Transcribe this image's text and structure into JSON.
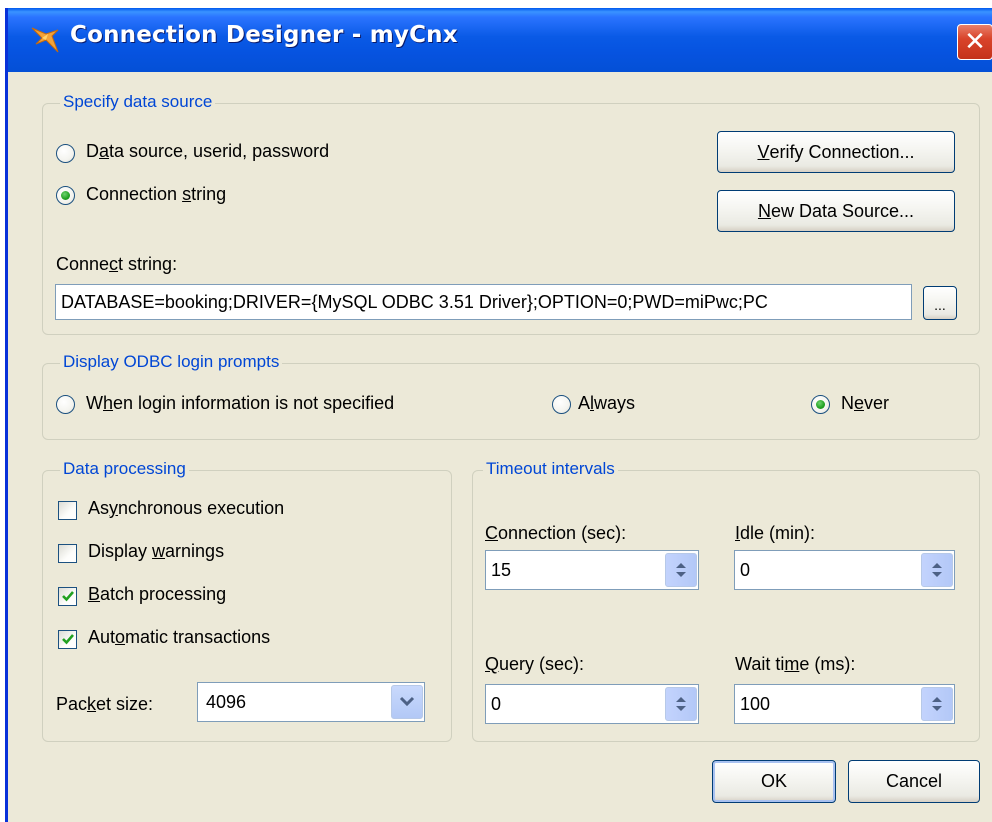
{
  "window": {
    "title": "Connection Designer - myCnx",
    "close_glyph": "✕"
  },
  "data_source": {
    "legend": "Specify data source",
    "option_dsn": {
      "pre": "D",
      "ul": "a",
      "post": "ta source, userid, password",
      "checked": false
    },
    "option_string": {
      "pre": "Connection ",
      "ul": "s",
      "post": "tring",
      "checked": true
    },
    "verify_button": {
      "pre": "",
      "ul": "V",
      "post": "erify Connection..."
    },
    "new_ds_button": {
      "pre": "",
      "ul": "N",
      "post": "ew Data Source..."
    },
    "connect_label": {
      "pre": "Conne",
      "ul": "c",
      "post": "t string:"
    },
    "connect_value": "DATABASE=booking;DRIVER={MySQL ODBC 3.51 Driver};OPTION=0;PWD=miPwc;PC",
    "browse_button": "..."
  },
  "odbc_prompts": {
    "legend": "Display ODBC login prompts",
    "option_when": {
      "pre": "W",
      "ul": "h",
      "post": "en login information is not specified",
      "checked": false
    },
    "option_always": {
      "pre": "A",
      "ul": "l",
      "post": "ways",
      "checked": false
    },
    "option_never": {
      "pre": "N",
      "ul": "e",
      "post": "ver",
      "checked": true
    }
  },
  "data_processing": {
    "legend": "Data processing",
    "async": {
      "pre": "As",
      "ul": "y",
      "post": "nchronous execution",
      "checked": false
    },
    "warnings": {
      "pre": "Display ",
      "ul": "w",
      "post": "arnings",
      "checked": false
    },
    "batch": {
      "pre": "",
      "ul": "B",
      "post": "atch processing",
      "checked": true
    },
    "auto_tx": {
      "pre": "Aut",
      "ul": "o",
      "post": "matic transactions",
      "checked": true
    },
    "packet_label": {
      "pre": "Pac",
      "ul": "k",
      "post": "et size:"
    },
    "packet_value": "4096"
  },
  "timeouts": {
    "legend": "Timeout intervals",
    "connection_label": {
      "pre": "",
      "ul": "C",
      "post": "onnection (sec):"
    },
    "connection_value": "15",
    "idle_label": {
      "pre": "",
      "ul": "I",
      "post": "dle (min):"
    },
    "idle_value": "0",
    "query_label": {
      "pre": "",
      "ul": "Q",
      "post": "uery (sec):"
    },
    "query_value": "0",
    "wait_label": {
      "pre": "Wait ti",
      "ul": "m",
      "post": "e (ms):"
    },
    "wait_value": "100"
  },
  "footer": {
    "ok_label": "OK",
    "cancel_label": "Cancel"
  },
  "colors": {
    "titlebar": "#0a5ae6",
    "group_legend": "#0046d5",
    "dialog_bg": "#ece9d8",
    "check_green": "#21a121"
  }
}
